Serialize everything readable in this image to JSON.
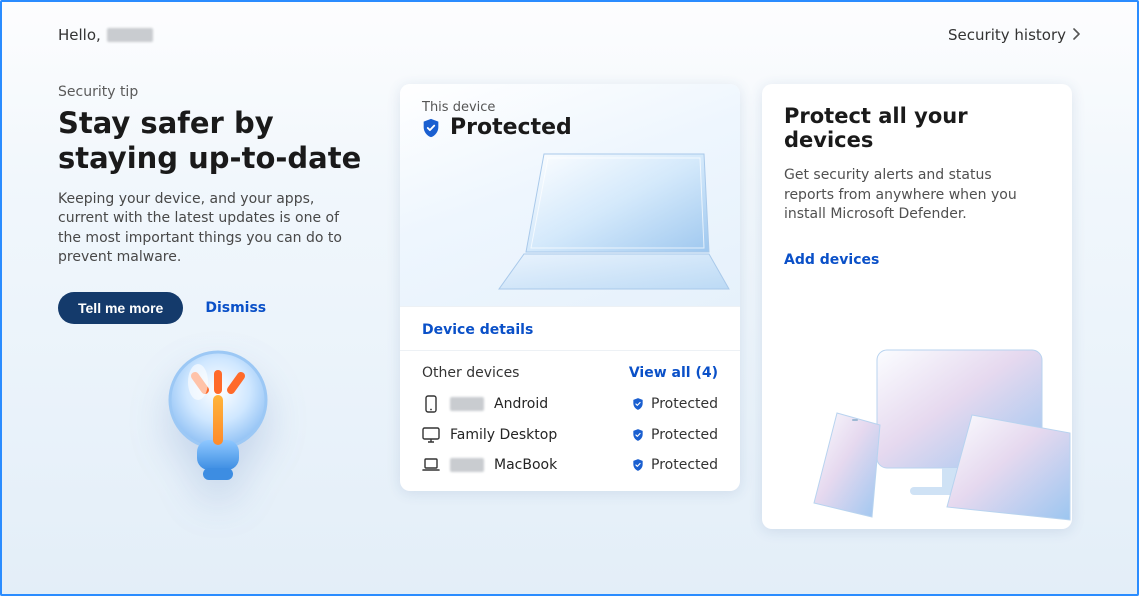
{
  "header": {
    "greeting_prefix": "Hello,",
    "security_history_label": "Security history"
  },
  "tip": {
    "eyebrow": "Security tip",
    "title": "Stay safer by staying up-to-date",
    "body": "Keeping your device, and your apps, current with the latest updates is one of the most important things you can do to prevent malware.",
    "primary_button": "Tell me more",
    "dismiss": "Dismiss"
  },
  "this_device": {
    "label": "This device",
    "status": "Protected",
    "details_link": "Device details"
  },
  "other_devices": {
    "title": "Other devices",
    "view_all_label": "View all  (4)",
    "items": [
      {
        "icon": "phone",
        "name_suffix": "Android",
        "status": "Protected"
      },
      {
        "icon": "desktop",
        "name": "Family Desktop",
        "status": "Protected"
      },
      {
        "icon": "laptop",
        "name_suffix": "MacBook",
        "status": "Protected"
      }
    ]
  },
  "protect": {
    "title": "Protect all your devices",
    "body": "Get security alerts and status reports from anywhere when you install Microsoft Defender.",
    "add_link": "Add devices"
  },
  "colors": {
    "accent": "#0a50c8",
    "primary_button_bg": "#143a6b",
    "shield": "#156c0"
  }
}
